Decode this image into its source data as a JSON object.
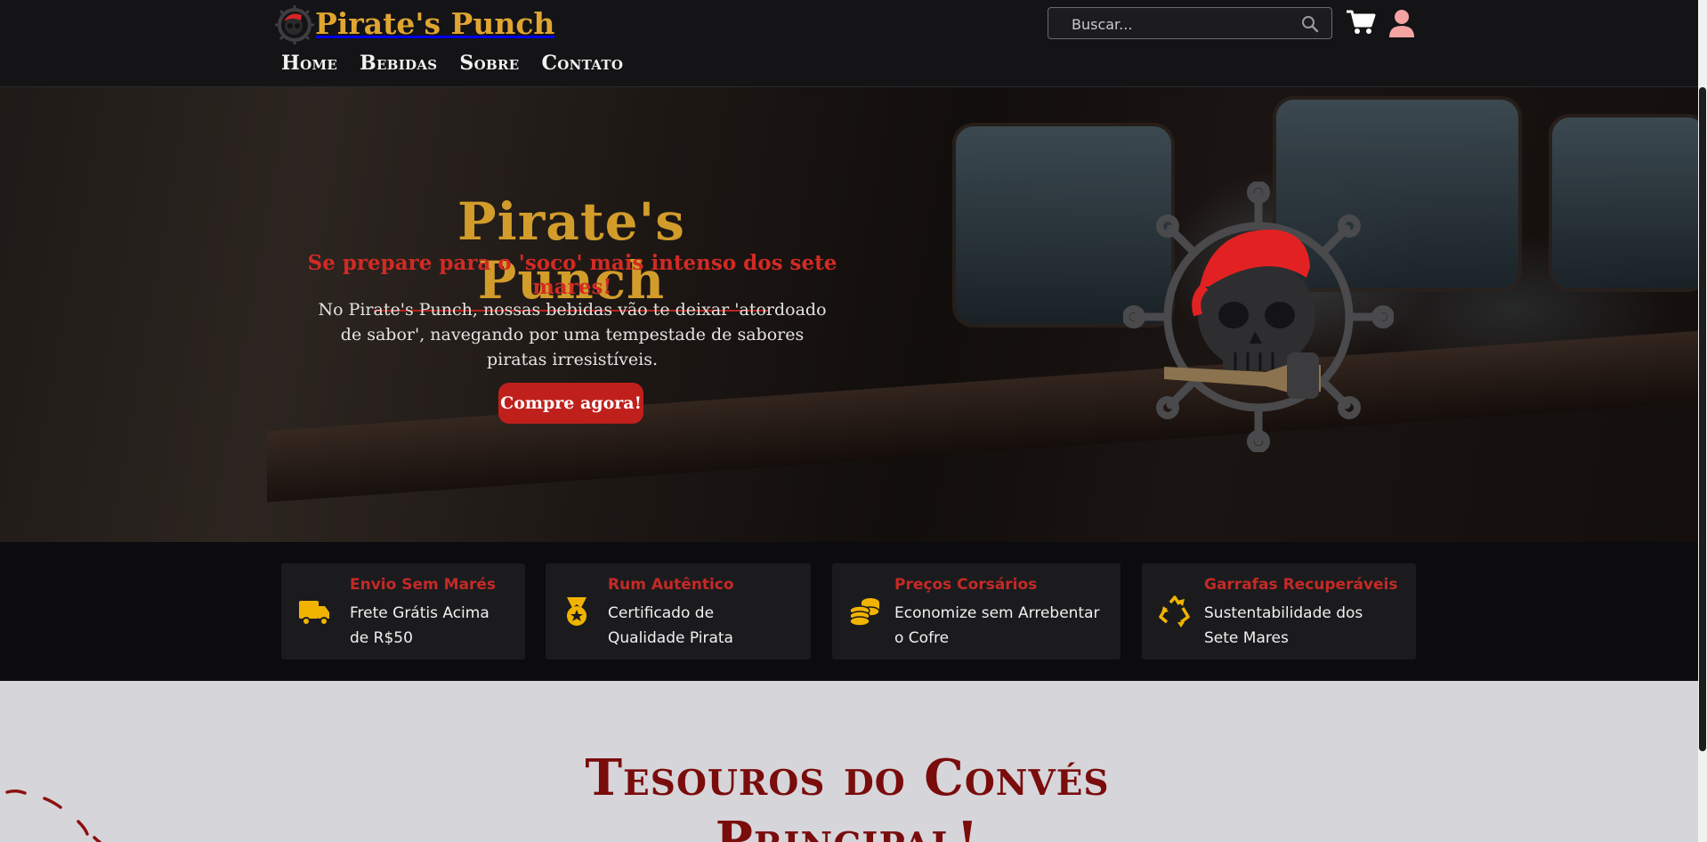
{
  "header": {
    "brand": "Pirate's Punch",
    "logo_icon": "pirate-skull-logo-icon",
    "nav": [
      {
        "label": "Home"
      },
      {
        "label": "Bebidas"
      },
      {
        "label": "Sobre"
      },
      {
        "label": "Contato"
      }
    ],
    "search": {
      "placeholder": "Buscar...",
      "value": "",
      "icon": "search-icon"
    },
    "cart_icon": "cart-icon",
    "user_icon": "user-icon"
  },
  "hero": {
    "title": "Pirate's Punch",
    "tagline": "Se prepare para o 'soco' mais intenso dos sete mares!",
    "description": "No Pirate's Punch, nossas bebidas vão te deixar 'atordoado de sabor', navegando por uma tempestade de sabores piratas irresistíveis.",
    "cta_label": "Compre agora!",
    "emblem_icon": "skull-ship-wheel-icon"
  },
  "features": [
    {
      "icon": "truck-icon",
      "title": "Envio Sem Marés",
      "description": "Frete Grátis Acima de R$50"
    },
    {
      "icon": "medal-icon",
      "title": "Rum Autêntico",
      "description": "Certificado de Qualidade Pirata"
    },
    {
      "icon": "coins-icon",
      "title": "Preços Corsários",
      "description": "Economize sem Arrebentar o Cofre"
    },
    {
      "icon": "recycle-icon",
      "title": "Garrafas Recuperáveis",
      "description": "Sustentabilidade dos Sete Mares"
    }
  ],
  "section": {
    "title": "Tesouros do Convés Principal!"
  },
  "colors": {
    "gold": "#d29c2b",
    "pirate_red": "#c0201c",
    "dark_red": "#7a0c0c",
    "feature_icon": "#f0b400",
    "header_bg": "#141416"
  }
}
